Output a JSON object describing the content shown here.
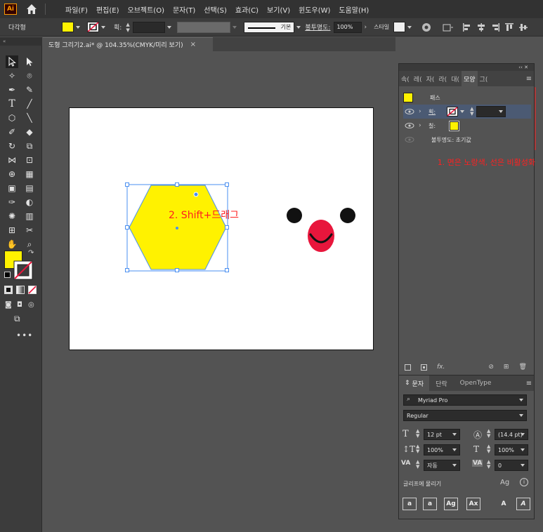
{
  "app": {
    "logo": "Ai"
  },
  "menu": [
    "파일(F)",
    "편집(E)",
    "오브젝트(O)",
    "문자(T)",
    "선택(S)",
    "효과(C)",
    "보기(V)",
    "윈도우(W)",
    "도움말(H)"
  ],
  "control_bar": {
    "selection_label": "다각형",
    "stroke_label": "획:",
    "stroke_style": "기본",
    "opacity_label": "불투명도:",
    "opacity_value": "100%",
    "style_label": "스타일",
    "fill_color": "#fff200"
  },
  "document": {
    "tab_title": "도형 그리기2.ai* @ 104.35%(CMYK/미리 보기)",
    "close": "×"
  },
  "annotations": {
    "step1": "1. 면은 노랑색, 선은 비활성화",
    "step2": "2. Shift+드래그"
  },
  "appearance_panel": {
    "tabs": [
      "속(",
      "레(",
      "자(",
      "라(",
      "대(",
      "모양",
      "그("
    ],
    "active_tab": "모양",
    "header": "패스",
    "stroke_row_label": "획:",
    "fill_row_label": "칠:",
    "opacity_row": "불투명도: 초기값",
    "fx": "fx."
  },
  "character_panel": {
    "tabs": [
      "문자",
      "단락",
      "OpenType"
    ],
    "font_family": "Myriad Pro",
    "font_style": "Regular",
    "font_size": "12 pt",
    "leading": "(14.4 pt)",
    "vertical_scale": "100%",
    "horizontal_scale": "100%",
    "kerning": "자동",
    "tracking": "0",
    "snap_label": "글리프에 물리기",
    "glyph_buttons": [
      "a",
      "a",
      "Ag",
      "Ax",
      "A",
      "A"
    ]
  },
  "colors": {
    "accent_red": "#e8163c",
    "fill_yellow": "#fff200",
    "selection_blue": "#4a8ff0",
    "annotation_red": "#ff2020"
  }
}
